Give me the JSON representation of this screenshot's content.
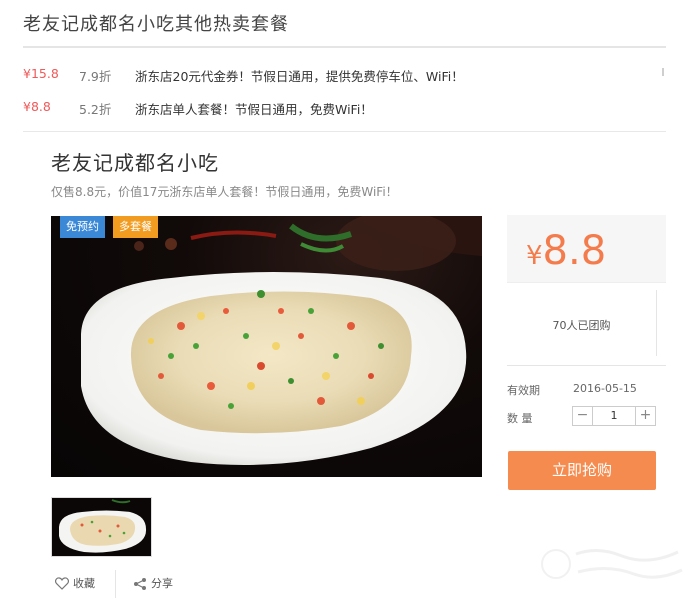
{
  "section": {
    "title": "老友记成都名小吃其他热卖套餐"
  },
  "deals": [
    {
      "price": "¥15.8",
      "discount": "7.9折",
      "title": "浙东店20元代金券！节假日通用，提供免费停车位、WiFi！"
    },
    {
      "price": "¥8.8",
      "discount": "5.2折",
      "title": "浙东店单人套餐！节假日通用，免费WiFi！"
    }
  ],
  "product": {
    "name": "老友记成都名小吃",
    "description": "仅售8.8元，价值17元浙东店单人套餐！节假日通用，免费WiFi！",
    "badges": [
      "免预约",
      "多套餐"
    ]
  },
  "purchase": {
    "currency": "¥",
    "price": "8.8",
    "sold_count": "70人已团购",
    "validity_label": "有效期",
    "validity_date": "2016-05-15",
    "quantity_label": "数 量",
    "quantity": "1",
    "minus": "−",
    "plus": "+",
    "buy_label": "立即抢购"
  },
  "actions": {
    "favorite_label": "收藏",
    "share_label": "分享"
  },
  "colors": {
    "price_red": "#f05a5a",
    "price_orange": "#f47b4b",
    "buy_button": "#f58b4e",
    "badge_blue": "#3b88d7",
    "badge_orange": "#f19c20"
  },
  "icons": {
    "favorite": "heart-icon",
    "share": "share-icon"
  }
}
